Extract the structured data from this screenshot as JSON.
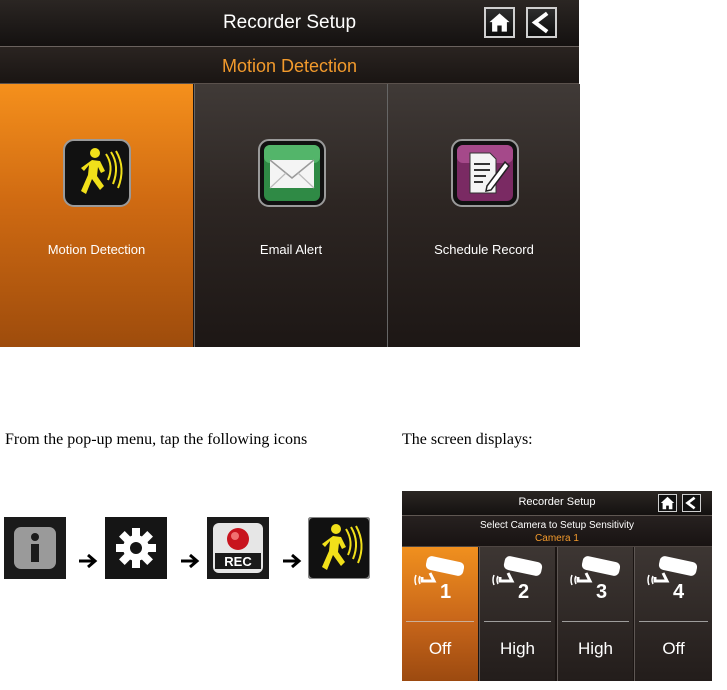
{
  "main_screen": {
    "title": "Recorder Setup",
    "subtitle": "Motion Detection",
    "home_icon": "home-icon",
    "back_icon": "back-icon",
    "tiles": [
      {
        "label": "Motion Detection",
        "icon": "motion-detection-icon",
        "selected": true
      },
      {
        "label": "Email Alert",
        "icon": "email-icon",
        "selected": false
      },
      {
        "label": "Schedule Record",
        "icon": "schedule-record-icon",
        "selected": false
      }
    ],
    "colors": {
      "accent": "#f29a2c",
      "selected_tile": "#e07a16"
    }
  },
  "instructions": {
    "text": "From the pop-up menu, tap the following icons",
    "sequence": [
      "info-icon",
      "gear-icon",
      "rec-icon",
      "motion-detection-icon"
    ],
    "rec_label": "REC"
  },
  "result": {
    "caption": "The screen displays:"
  },
  "mini_screen": {
    "title": "Recorder Setup",
    "subtitle": "Select Camera to Setup Sensitivity",
    "camera_label": "Camera 1",
    "cameras": [
      {
        "number": "1",
        "sensitivity": "Off",
        "selected": true
      },
      {
        "number": "2",
        "sensitivity": "High",
        "selected": false
      },
      {
        "number": "3",
        "sensitivity": "High",
        "selected": false
      },
      {
        "number": "4",
        "sensitivity": "Off",
        "selected": false
      }
    ]
  }
}
